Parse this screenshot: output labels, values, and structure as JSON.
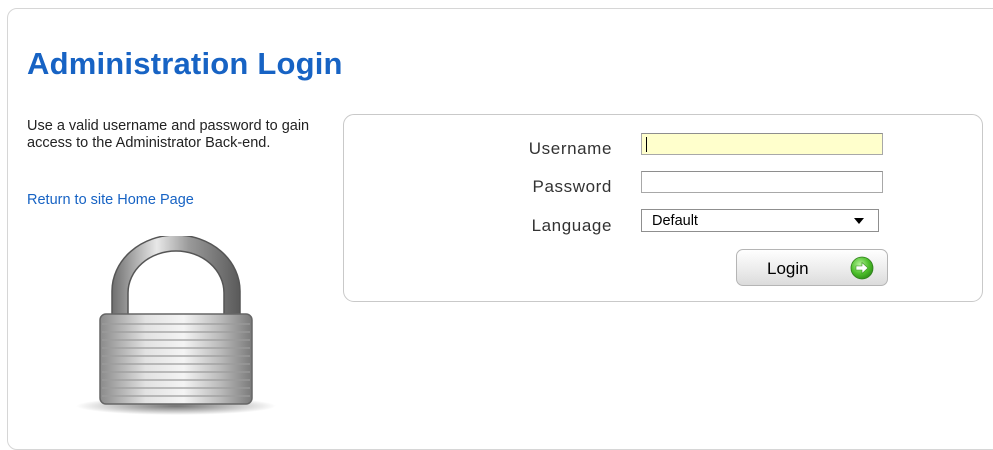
{
  "page": {
    "title": "Administration Login",
    "description": "Use a valid username and password to gain access to the Administrator Back-end.",
    "return_link": "Return to site Home Page"
  },
  "form": {
    "username_label": "Username",
    "username_value": "",
    "password_label": "Password",
    "password_value": "",
    "language_label": "Language",
    "language_selected": "Default",
    "login_label": "Login"
  },
  "colors": {
    "title_blue": "#1763c4",
    "focused_input_bg": "#ffffcc",
    "go_green": "#4cbf2a"
  },
  "icons": {
    "lock": "padlock-icon",
    "go": "green-arrow-circle-icon",
    "dropdown": "chevron-down-icon"
  }
}
